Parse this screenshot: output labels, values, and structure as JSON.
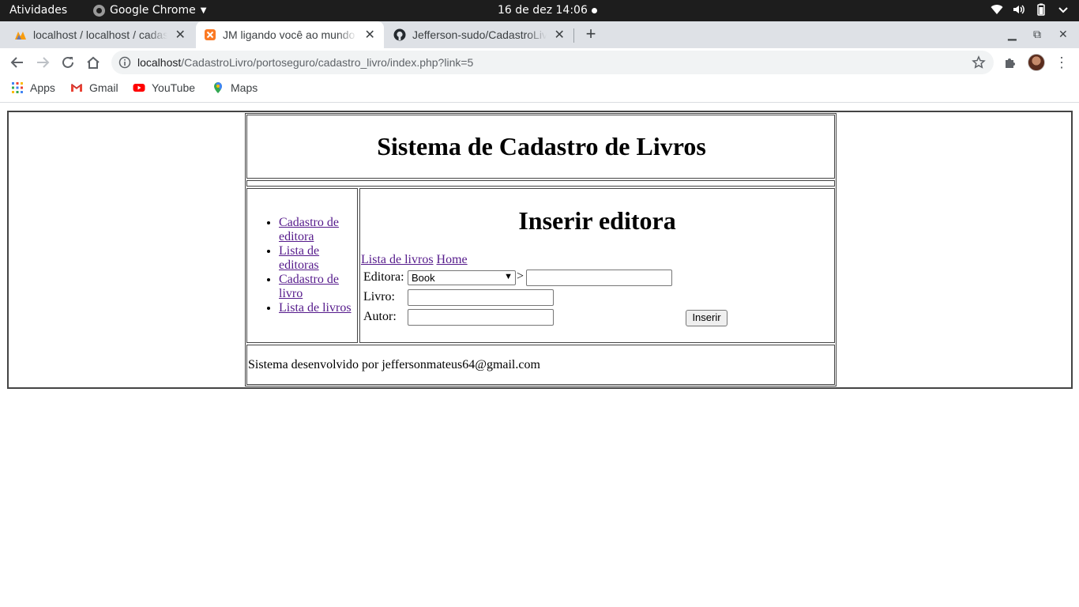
{
  "os": {
    "activities": "Atividades",
    "app_name": "Google Chrome",
    "clock": "16 de dez  14:06"
  },
  "tabs": [
    {
      "title": "localhost / localhost / cadastro",
      "icon": "phpmyadmin-icon"
    },
    {
      "title": "JM ligando você ao mundo",
      "icon": "xampp-icon"
    },
    {
      "title": "Jefferson-sudo/CadastroLivro",
      "icon": "github-icon"
    }
  ],
  "address_bar": {
    "host": "localhost",
    "path": "/CadastroLivro/portoseguro/cadastro_livro/index.php?link=5"
  },
  "bookmarks": [
    {
      "label": "Apps",
      "icon": "apps-grid-icon"
    },
    {
      "label": "Gmail",
      "icon": "gmail-icon"
    },
    {
      "label": "YouTube",
      "icon": "youtube-icon"
    },
    {
      "label": "Maps",
      "icon": "maps-pin-icon"
    }
  ],
  "page": {
    "site_title": "Sistema de Cadastro de Livros",
    "menu": [
      "Cadastro de editora",
      "Lista de editoras",
      "Cadastro de livro",
      "Lista de livros"
    ],
    "form_title": "Inserir editora",
    "links": [
      "Lista de livros",
      "Home"
    ],
    "form": {
      "editora_label": "Editora:",
      "editora_selected": "Book",
      "separator": ">",
      "livro_label": "Livro:",
      "autor_label": "Autor:",
      "submit_label": "Inserir"
    },
    "footer": "Sistema desenvolvido por jeffersonmateus64@gmail.com"
  },
  "colors": {
    "link_visited": "#551a8b",
    "tabstrip_bg": "#dee1e6",
    "topbar_bg": "#1d1d1d"
  }
}
